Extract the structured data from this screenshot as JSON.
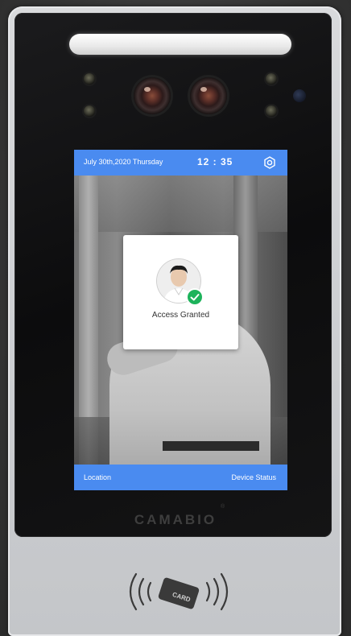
{
  "topbar": {
    "date": "July 30th,2020 Thursday",
    "time": "12 : 35",
    "settings_icon": "gear-icon"
  },
  "popup": {
    "status": "Access Granted",
    "badge_icon": "check-icon",
    "badge_color": "#1db35b"
  },
  "bottombar": {
    "location_label": "Location",
    "device_status_label": "Device Status"
  },
  "device": {
    "brand": "CAMABIO",
    "registered_mark": "®",
    "card_icon": "nfc-card-icon",
    "card_label": "CARD"
  },
  "colors": {
    "bar_accent": "#4a8bf0",
    "success": "#1db35b"
  }
}
